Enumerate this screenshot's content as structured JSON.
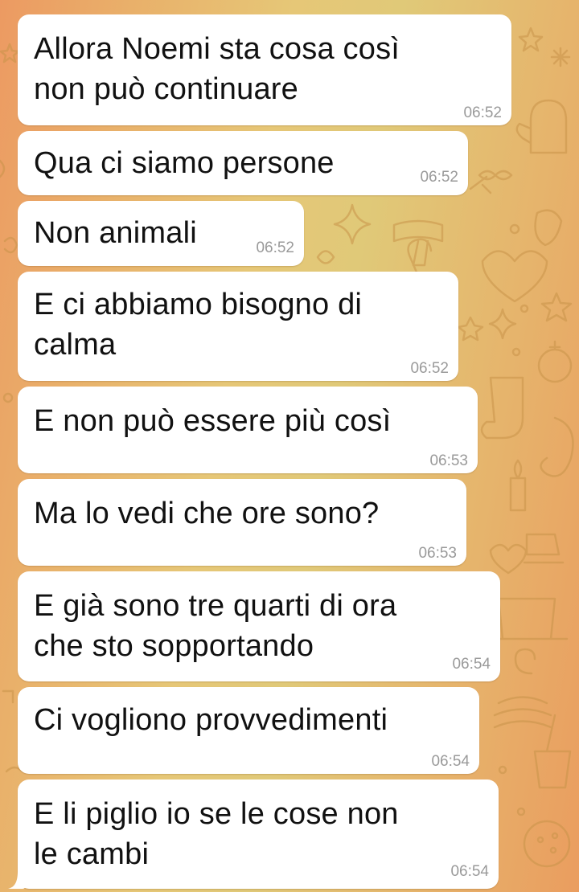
{
  "chat": {
    "messages": [
      {
        "text": "Allora Noemi sta cosa così\nnon può continuare",
        "time": "06:52"
      },
      {
        "text": "Qua ci siamo persone",
        "time": "06:52"
      },
      {
        "text": "Non animali",
        "time": "06:52"
      },
      {
        "text": "E ci abbiamo bisogno di\ncalma",
        "time": "06:52"
      },
      {
        "text": "E non può essere più così",
        "time": "06:53"
      },
      {
        "text": "Ma lo vedi che ore sono?",
        "time": "06:53"
      },
      {
        "text": "E già sono tre quarti di ora\nche sto sopportando",
        "time": "06:54"
      },
      {
        "text": "Ci vogliono provvedimenti",
        "time": "06:54"
      },
      {
        "text": "E li piglio io se le cose non\nle cambi",
        "time": "06:54"
      }
    ]
  },
  "colors": {
    "bubble": "#ffffff",
    "text": "#111111",
    "timestamp": "#9a9a9a",
    "wallpaper_gradient": [
      "#ec9a62",
      "#e6c777",
      "#ea9d5f"
    ]
  }
}
